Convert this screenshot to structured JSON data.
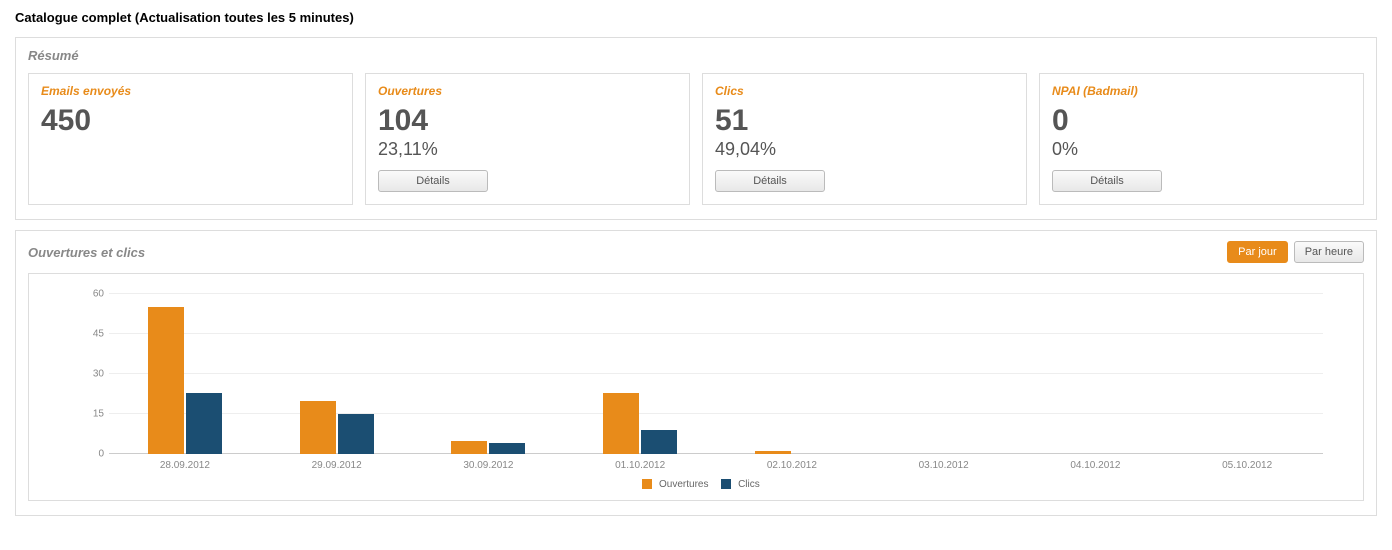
{
  "page": {
    "title": "Catalogue complet (Actualisation toutes les 5 minutes)"
  },
  "summary": {
    "title": "Résumé",
    "cards": {
      "sent": {
        "label": "Emails envoyés",
        "value": "450"
      },
      "opens": {
        "label": "Ouvertures",
        "value": "104",
        "pct": "23,11%",
        "details": "Détails"
      },
      "clicks": {
        "label": "Clics",
        "value": "51",
        "pct": "49,04%",
        "details": "Détails"
      },
      "npai": {
        "label": "NPAI (Badmail)",
        "value": "0",
        "pct": "0%",
        "details": "Détails"
      }
    }
  },
  "chart_panel": {
    "title": "Ouvertures et clics",
    "toggle": {
      "day": "Par jour",
      "hour": "Par heure"
    },
    "legend": {
      "ouvertures": "Ouvertures",
      "clics": "Clics"
    }
  },
  "chart_data": {
    "type": "bar",
    "categories": [
      "28.09.2012",
      "29.09.2012",
      "30.09.2012",
      "01.10.2012",
      "02.10.2012",
      "03.10.2012",
      "04.10.2012",
      "05.10.2012"
    ],
    "series": [
      {
        "name": "Ouvertures",
        "values": [
          55,
          20,
          5,
          23,
          1,
          0,
          0,
          0
        ]
      },
      {
        "name": "Clics",
        "values": [
          23,
          15,
          4,
          9,
          0,
          0,
          0,
          0
        ]
      }
    ],
    "yticks": [
      0,
      15,
      30,
      45,
      60
    ],
    "ylim": [
      0,
      60
    ],
    "xlabel": "",
    "ylabel": "",
    "title": ""
  }
}
